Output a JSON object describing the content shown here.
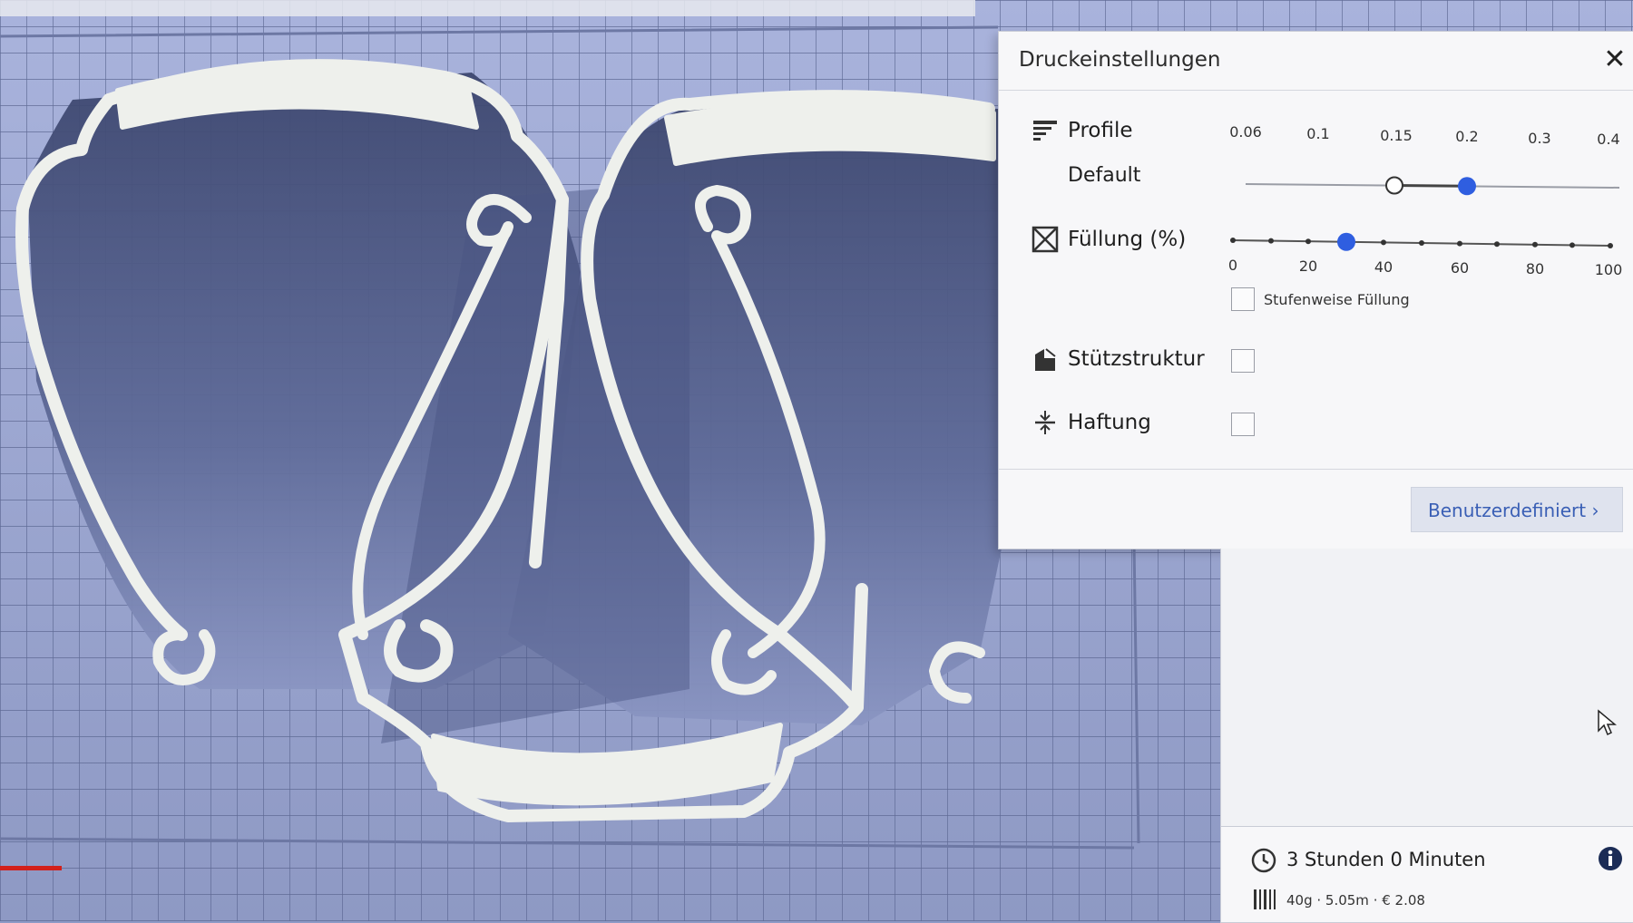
{
  "panel": {
    "title": "Druckeinstellungen",
    "close_symbol": "✕",
    "profile": {
      "label": "Profile",
      "selected": "Default",
      "tick_labels": [
        "0.06",
        "0.1",
        "0.15",
        "0.2",
        "0.3",
        "0.4"
      ],
      "current_index": 3,
      "default_index": 2
    },
    "infill": {
      "label": "Füllung (%)",
      "tick_labels": [
        "0",
        "20",
        "40",
        "60",
        "80",
        "100"
      ],
      "value": 30,
      "gradual_label": "Stufenweise Füllung",
      "gradual_checked": false
    },
    "support": {
      "label": "Stützstruktur",
      "checked": false
    },
    "adhesion": {
      "label": "Haftung",
      "checked": false
    },
    "custom_button": "Benutzerdefiniert ›"
  },
  "job": {
    "time": "3 Stunden 0 Minuten",
    "stats": "40g · 5.05m · € 2.08"
  },
  "icons": [
    "profile-icon",
    "infill-icon",
    "support-icon",
    "adhesion-icon",
    "clock-icon",
    "filament-icon",
    "info-icon",
    "close-icon",
    "mouse-cursor-icon"
  ],
  "colors": {
    "accent": "#2f5ee0",
    "bed": "#8d9ac6",
    "model": "#eef0ec",
    "button_text": "#3a5fb5"
  }
}
